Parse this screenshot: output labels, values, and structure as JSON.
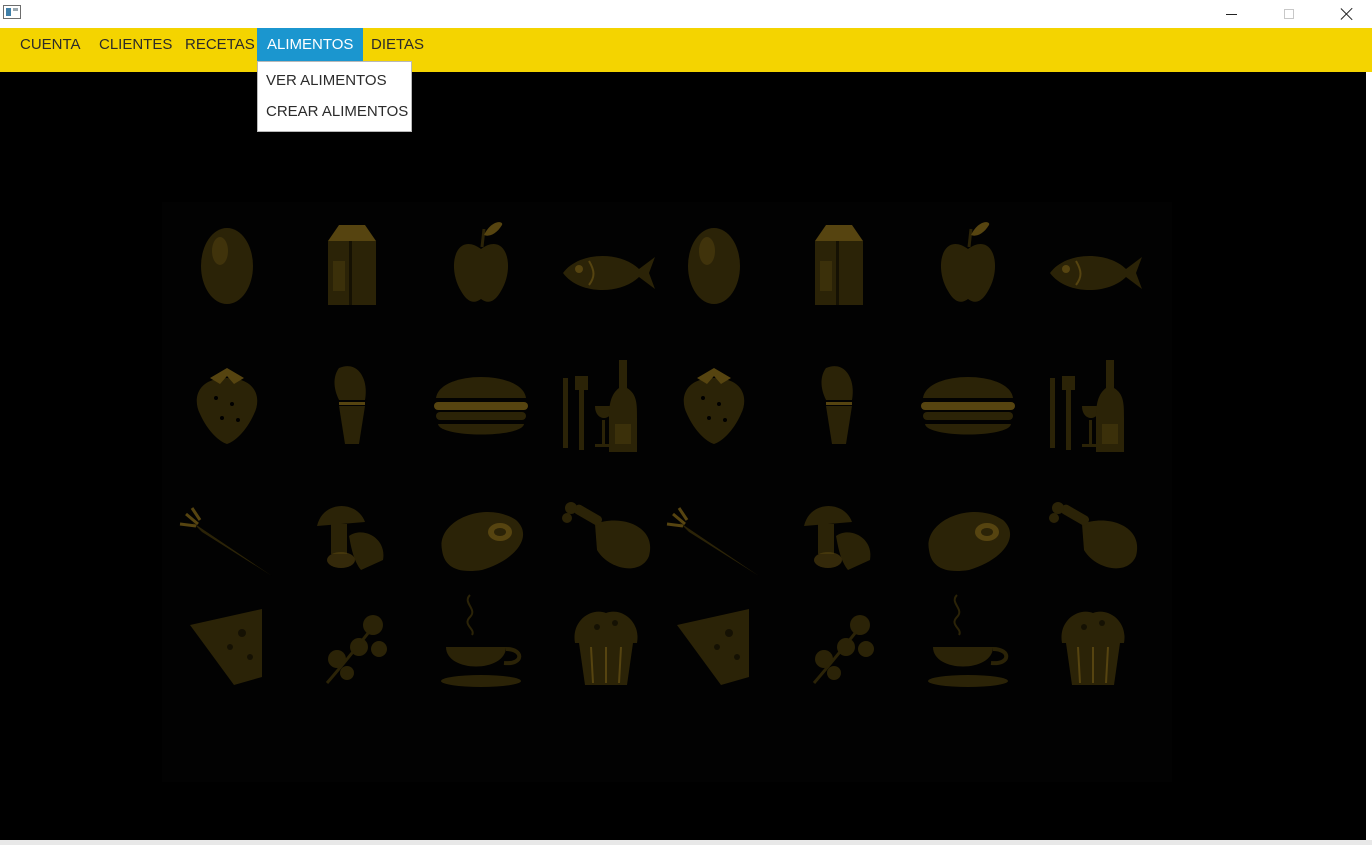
{
  "window": {
    "icons": {
      "app": "app-window-icon",
      "minimize": "minimize-icon",
      "maximize": "maximize-icon",
      "close": "close-icon"
    }
  },
  "menubar": {
    "items": [
      {
        "label": "CUENTA"
      },
      {
        "label": "CLIENTES"
      },
      {
        "label": "RECETAS"
      },
      {
        "label": "ALIMENTOS",
        "active": true
      },
      {
        "label": "DIETAS"
      }
    ]
  },
  "dropdown": {
    "items": [
      {
        "label": "VER ALIMENTOS"
      },
      {
        "label": "CREAR ALIMENTOS"
      }
    ]
  },
  "background_pattern": {
    "icon_rows": [
      [
        "egg-icon",
        "milk-carton-icon",
        "apple-icon",
        "fish-icon",
        "egg-icon",
        "milk-carton-icon",
        "apple-icon",
        "fish-icon"
      ],
      [
        "strawberry-icon",
        "ice-cream-icon",
        "burger-icon",
        "cutlery-wine-icon",
        "strawberry-icon",
        "ice-cream-icon",
        "burger-icon",
        "cutlery-wine-icon"
      ],
      [
        "carrot-icon",
        "mushroom-icon",
        "steak-icon",
        "chicken-leg-icon",
        "carrot-icon",
        "mushroom-icon",
        "steak-icon",
        "chicken-leg-icon"
      ],
      [
        "cheese-icon",
        "parsley-icon",
        "coffee-cup-icon",
        "muffin-icon",
        "cheese-icon",
        "parsley-icon",
        "coffee-cup-icon",
        "muffin-icon"
      ]
    ]
  },
  "colors": {
    "menubar_bg": "#f4d400",
    "menu_active_bg": "#1b96cf",
    "content_bg": "#000000",
    "icon_tint": "#2b2307",
    "icon_highlight": "#564410"
  }
}
